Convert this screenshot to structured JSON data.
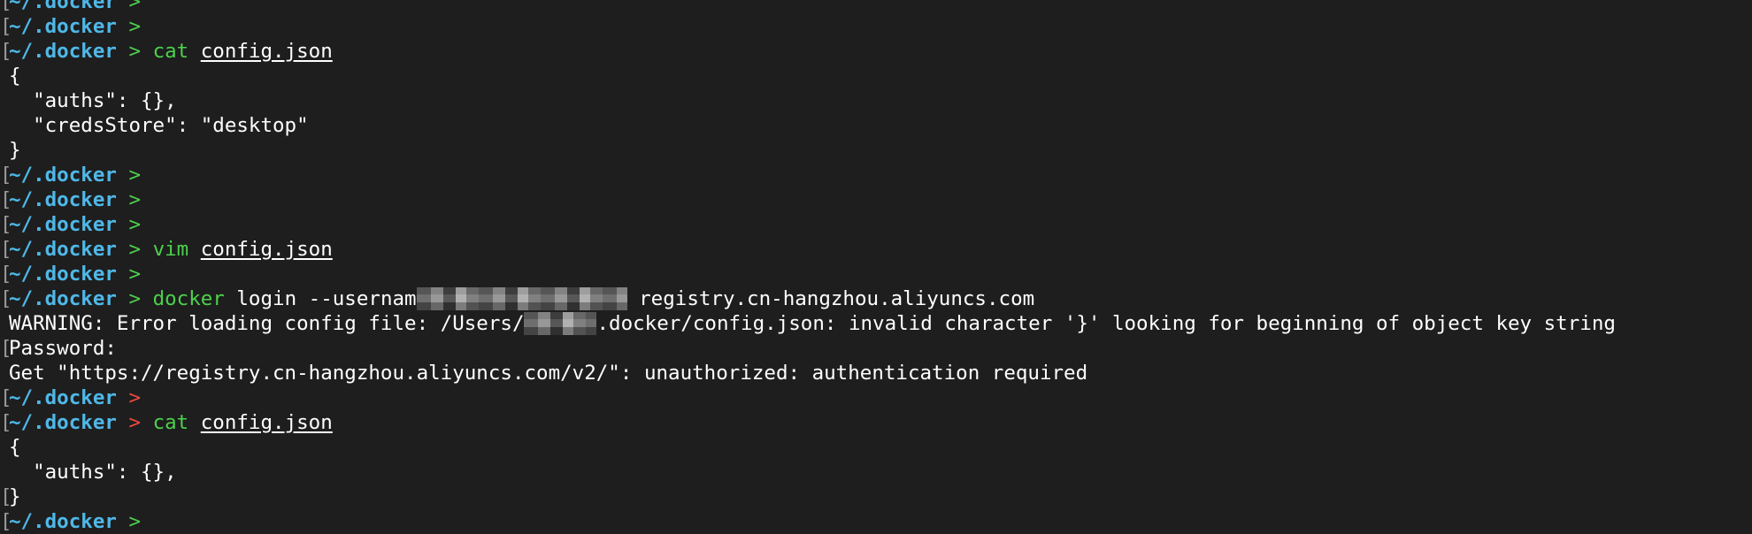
{
  "terminal": {
    "prompt_path": "~/.docker",
    "prompt_arrow": ">",
    "lines": [
      {
        "type": "prompt",
        "status": "ok"
      },
      {
        "type": "prompt",
        "status": "ok"
      },
      {
        "type": "prompt",
        "status": "ok",
        "cmd": "cat",
        "arg": "config.json"
      },
      {
        "type": "output",
        "text": "{"
      },
      {
        "type": "output",
        "text": "  \"auths\": {},"
      },
      {
        "type": "output",
        "text": "  \"credsStore\": \"desktop\""
      },
      {
        "type": "output",
        "text": "}"
      },
      {
        "type": "prompt",
        "status": "ok"
      },
      {
        "type": "prompt",
        "status": "ok"
      },
      {
        "type": "prompt",
        "status": "ok"
      },
      {
        "type": "prompt",
        "status": "ok",
        "cmd": "vim",
        "arg": "config.json"
      },
      {
        "type": "prompt",
        "status": "ok"
      },
      {
        "type": "prompt",
        "status": "ok",
        "cmd": "docker",
        "rest_before": " login --usernam",
        "redacted": true,
        "rest_after": " registry.cn-hangzhou.aliyuncs.com"
      },
      {
        "type": "warning",
        "before": "WARNING: Error loading config file: /Users/",
        "after": ".docker/config.json: invalid character '}' looking for beginning of object key string"
      },
      {
        "type": "output",
        "text": "Password:",
        "bracket": true
      },
      {
        "type": "output",
        "text": "Get \"https://registry.cn-hangzhou.aliyuncs.com/v2/\": unauthorized: authentication required"
      },
      {
        "type": "prompt",
        "status": "err"
      },
      {
        "type": "prompt",
        "status": "err",
        "cmd": "cat",
        "arg": "config.json"
      },
      {
        "type": "output",
        "text": "{"
      },
      {
        "type": "output",
        "text": "  \"auths\": {},"
      },
      {
        "type": "output",
        "text": "}",
        "bracket": true
      },
      {
        "type": "prompt",
        "status": "ok"
      }
    ]
  },
  "colors": {
    "background": "#1e1e1e",
    "path": "#4fb8e8",
    "arrow_ok": "#4cd14c",
    "arrow_err": "#f0493e",
    "command": "#4cd14c",
    "text": "#ffffff"
  }
}
